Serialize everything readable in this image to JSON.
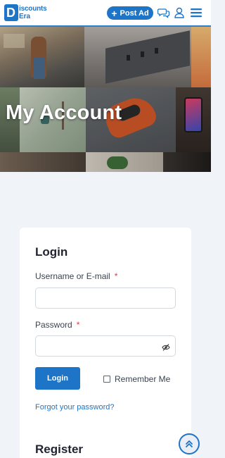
{
  "header": {
    "logo_line1": "iscounts",
    "logo_line2": "Era",
    "logo_letter": "D",
    "post_ad_label": "Post Ad",
    "icons": [
      "chat-icon",
      "user-icon",
      "menu-icon"
    ],
    "accent_color": "#1e74c7"
  },
  "hero": {
    "title": "My Account"
  },
  "login": {
    "title": "Login",
    "username_label": "Username or E-mail",
    "username_required": "*",
    "username_value": "",
    "password_label": "Password",
    "password_required": "*",
    "password_value": "",
    "login_button": "Login",
    "remember_label": "Remember Me",
    "forgot_link": "Forgot your password?"
  },
  "register": {
    "title": "Register"
  }
}
